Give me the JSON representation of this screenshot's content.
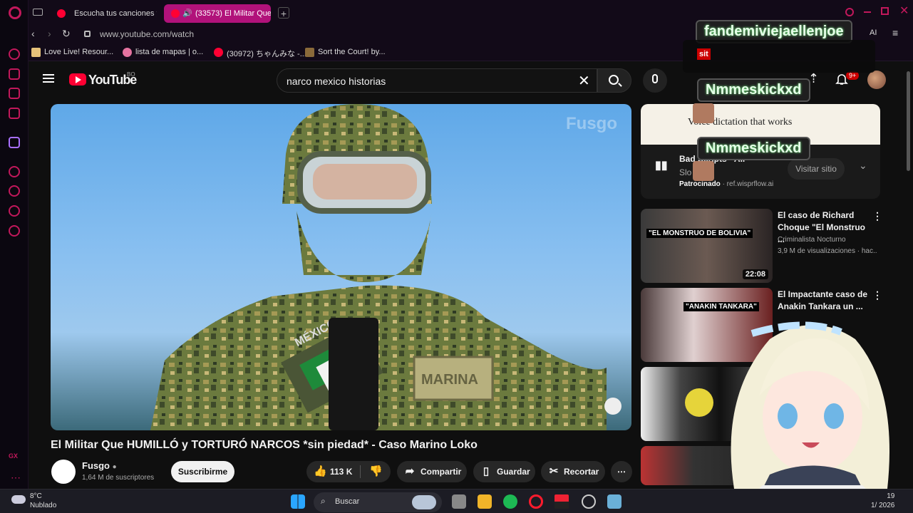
{
  "browser": {
    "tabs": [
      {
        "label": "Escucha tus canciones y a",
        "active": false
      },
      {
        "label": "(33573) El Militar Que",
        "active": true
      }
    ],
    "url": "www.youtube.com/watch",
    "ai_label": "AI",
    "bookmarks": [
      "Love Live! Resour...",
      "lista de mapas | o...",
      "(30972) ちゃんみな -...",
      "Sort the Court! by..."
    ]
  },
  "youtube": {
    "logo_text": "YouTube",
    "country_code": "BO",
    "search_query": "narco mexico historias",
    "notification_count": "9+",
    "brand_color": "#ff0033"
  },
  "video": {
    "watermark": "Fusgo",
    "patch_text": "MÉXICO",
    "name_tape": "MARINA",
    "title": "El Militar Que HUMILLÓ y TORTURÓ NARCOS *sin piedad* - Caso Marino Loko",
    "channel": "Fusgo",
    "subscribers": "1,64 M de suscriptores",
    "subscribe_label": "Suscribirme",
    "likes": "113 K",
    "share_label": "Compartir",
    "save_label": "Guardar",
    "clip_label": "Recortar"
  },
  "ad": {
    "image_text": "Voice dictation that works",
    "title": "Bad Scripts - All",
    "subtitle": "Slo",
    "sponsored": "Patrocinado",
    "domain": "· ref.wisprflow.ai",
    "visit_label": "Visitar sitio"
  },
  "recommendations": [
    {
      "title": "El caso de Richard Choque \"El Monstruo ...",
      "channel": "Criminalista Nocturno",
      "views": "3,9 M de visualizaciones · hac...",
      "duration": "22:08",
      "thumb_text": "\"EL MONSTRUO DE BOLIVIA\""
    },
    {
      "title": "El Impactante caso de Anakin Tankara un ...",
      "channel": "",
      "views": "",
      "duration": "",
      "thumb_text": "\"ANAKIN TANKARA\""
    },
    {
      "title": "",
      "channel": "",
      "views": "",
      "duration": "",
      "thumb_text": ""
    },
    {
      "title": "",
      "channel": "",
      "views": "",
      "duration": "",
      "thumb_text": ""
    }
  ],
  "overlays": {
    "user1": "fandemiviejaellenjoe",
    "user2": "Nmmeskickxd",
    "user3": "Nmmeskickxd",
    "tag": "sit"
  },
  "taskbar": {
    "temperature": "8°C",
    "condition": "Nublado",
    "search_placeholder": "Buscar",
    "time": "19",
    "date": "1/ 2026"
  }
}
